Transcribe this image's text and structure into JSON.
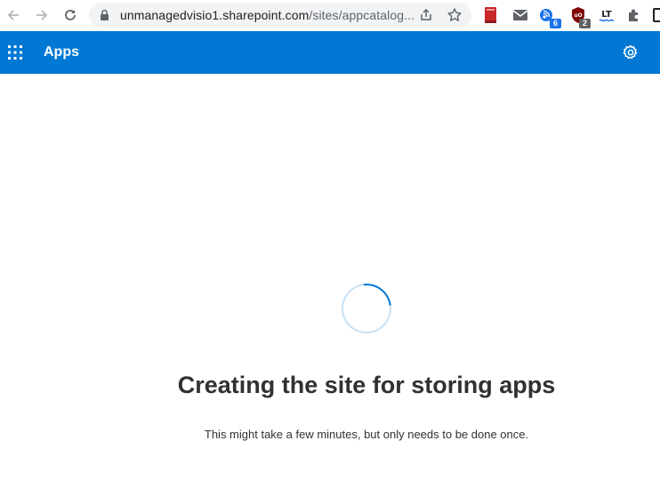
{
  "browser": {
    "url_host": "unmanagedvisio1.sharepoint.com",
    "url_path": "/sites/appcatalog...",
    "extensions": [
      {
        "name": "book-extension",
        "badge": ""
      },
      {
        "name": "mail-extension",
        "badge": ""
      },
      {
        "name": "rss-extension",
        "badge": "6"
      },
      {
        "name": "ublock-extension",
        "badge": "2"
      },
      {
        "name": "languagetool-extension",
        "badge": ""
      },
      {
        "name": "puzzle-extensions",
        "badge": ""
      }
    ]
  },
  "suite_bar": {
    "title": "Apps",
    "accent": "#0078d4"
  },
  "main": {
    "heading": "Creating the site for storing apps",
    "subtext": "This might take a few minutes, but only needs to be done once."
  }
}
